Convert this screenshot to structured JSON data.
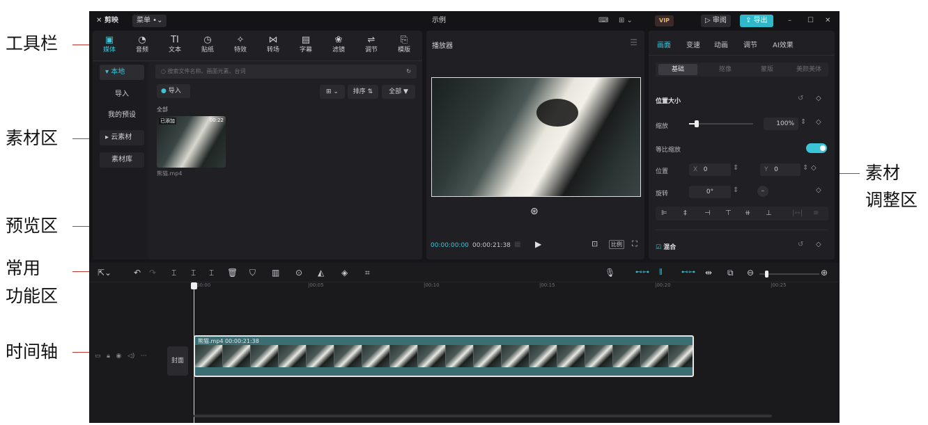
{
  "callouts": {
    "toolbar": "工具栏",
    "assets": "素材区",
    "preview": "预览区",
    "common_line1": "常用",
    "common_line2": "功能区",
    "timeline": "时间轴",
    "adjust_line1": "素材",
    "adjust_line2": "调整区"
  },
  "titlebar": {
    "logo": "剪映",
    "menu": "菜单",
    "project_name": "示例",
    "vip": "VIP",
    "review": "审阅",
    "export": "导出"
  },
  "toolbar": {
    "items": [
      {
        "label": "媒体",
        "icon": "▣"
      },
      {
        "label": "音频",
        "icon": "◔"
      },
      {
        "label": "文本",
        "icon": "TI"
      },
      {
        "label": "贴纸",
        "icon": "◷"
      },
      {
        "label": "特效",
        "icon": "✧"
      },
      {
        "label": "转场",
        "icon": "⋈"
      },
      {
        "label": "字幕",
        "icon": "▤"
      },
      {
        "label": "滤镜",
        "icon": "❀"
      },
      {
        "label": "调节",
        "icon": "⇌"
      },
      {
        "label": "模版",
        "icon": "⎘"
      }
    ]
  },
  "media_sidebar": {
    "items": [
      "本地",
      "导入",
      "我的预设",
      "云素材",
      "素材库"
    ]
  },
  "media": {
    "search_placeholder": "搜索文件名称、画面元素、台词",
    "import_label": "导入",
    "sort_label": "排序",
    "all_label": "全部",
    "section_label": "全部",
    "clip": {
      "badge": "已添加",
      "duration": "00:22",
      "filename": "熊猫.mp4"
    }
  },
  "player": {
    "title": "播放器",
    "current_time": "00:00:00:00",
    "total_time": "00:00:21:38",
    "ratio_label": "比例"
  },
  "inspector": {
    "tabs": [
      "画面",
      "变速",
      "动画",
      "调节",
      "AI效果"
    ],
    "subtabs": [
      "基础",
      "抠像",
      "蒙版",
      "美颜美体"
    ],
    "position_size": "位置大小",
    "scale_label": "缩放",
    "scale_value": "100%",
    "scale_fraction": 0.12,
    "uniform_label": "等比缩放",
    "position_label": "位置",
    "x_label": "X",
    "x_value": "0",
    "y_label": "Y",
    "y_value": "0",
    "rotate_label": "旋转",
    "rotate_value": "0°",
    "blend_label": "混合"
  },
  "timeline": {
    "ticks": [
      "00:00",
      "|00:05",
      "|00:10",
      "|00:15",
      "|00:20",
      "|00:25"
    ],
    "track_cover": "封面",
    "clip_label": "熊猫.mp4  00:00:21:38"
  }
}
